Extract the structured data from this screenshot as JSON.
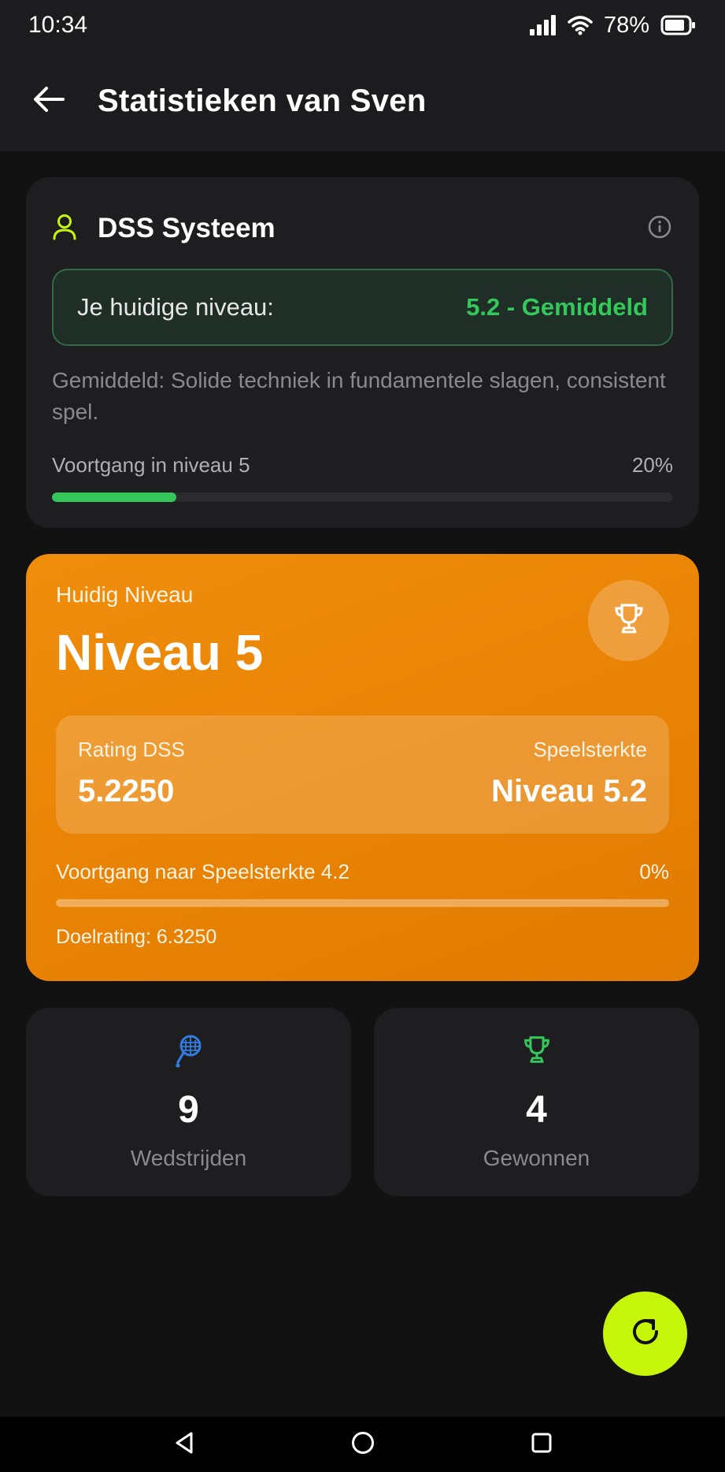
{
  "status_bar": {
    "time": "10:34",
    "battery": "78%",
    "icons": [
      "signal-icon",
      "wifi-icon",
      "battery-icon"
    ]
  },
  "app_bar": {
    "title": "Statistieken van Sven",
    "back_icon": "arrow-left-icon"
  },
  "dss_card": {
    "title": "DSS Systeem",
    "icon": "user-icon",
    "info_icon": "info-icon",
    "current_level_label": "Je huidige niveau:",
    "current_level_value": "5.2 - Gemiddeld",
    "description": "Gemiddeld: Solide techniek in fundamentele slagen, consistent spel.",
    "progress_label": "Voortgang in niveau 5",
    "progress_percent": "20%",
    "progress_fraction": 0.2,
    "accent_color": "#34c759"
  },
  "level_card": {
    "subtitle": "Huidig Niveau",
    "title": "Niveau 5",
    "trophy_icon": "trophy-icon",
    "rating_label": "Rating DSS",
    "rating_value": "5.2250",
    "strength_label": "Speelsterkte",
    "strength_value": "Niveau 5.2",
    "progress_label": "Voortgang naar Speelsterkte 4.2",
    "progress_percent": "0%",
    "progress_fraction": 0.0,
    "target_rating": "Doelrating: 6.3250",
    "color": "#ea8406"
  },
  "stats": [
    {
      "icon": "tennis-racket-icon",
      "value": "9",
      "label": "Wedstrijden",
      "icon_color": "#2f7de1"
    },
    {
      "icon": "trophy-icon",
      "value": "4",
      "label": "Gewonnen",
      "icon_color": "#34c759"
    }
  ],
  "fab": {
    "icon": "refresh-icon",
    "color": "#c6f70a"
  },
  "nav_bar": {
    "icons": [
      "back-triangle-icon",
      "home-circle-icon",
      "recents-square-icon"
    ]
  }
}
